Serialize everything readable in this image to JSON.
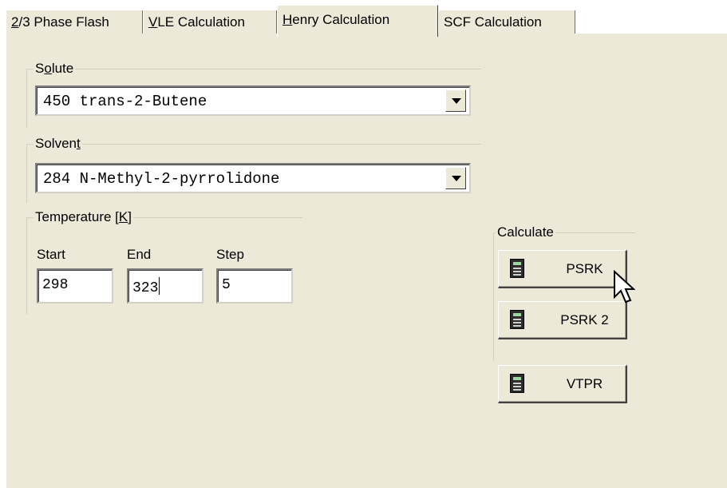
{
  "tabs": [
    {
      "prefix": "",
      "mnemonic": "2",
      "rest": "/3 Phase Flash"
    },
    {
      "prefix": "",
      "mnemonic": "V",
      "rest": "LE Calculation"
    },
    {
      "prefix": "",
      "mnemonic": "H",
      "rest": "enry Calculation"
    },
    {
      "prefix": "SCF Calculation",
      "mnemonic": "",
      "rest": ""
    }
  ],
  "active_tab": "Henry Calculation",
  "solute": {
    "label_pre": "S",
    "label_mn": "o",
    "label_post": "lute",
    "value": "450 trans-2-Butene"
  },
  "solvent": {
    "label_pre": "Solven",
    "label_mn": "t",
    "label_post": "",
    "value": "284 N-Methyl-2-pyrrolidone"
  },
  "temperature": {
    "label_pre": "Temperature [",
    "label_mn": "K",
    "label_post": "]",
    "start_label": "Start",
    "end_label": "End",
    "step_label": "Step",
    "start": "298",
    "end": "323",
    "step": "5"
  },
  "calculate": {
    "label": "Calculate",
    "buttons": [
      "PSRK",
      "PSRK 2",
      "VTPR"
    ]
  }
}
